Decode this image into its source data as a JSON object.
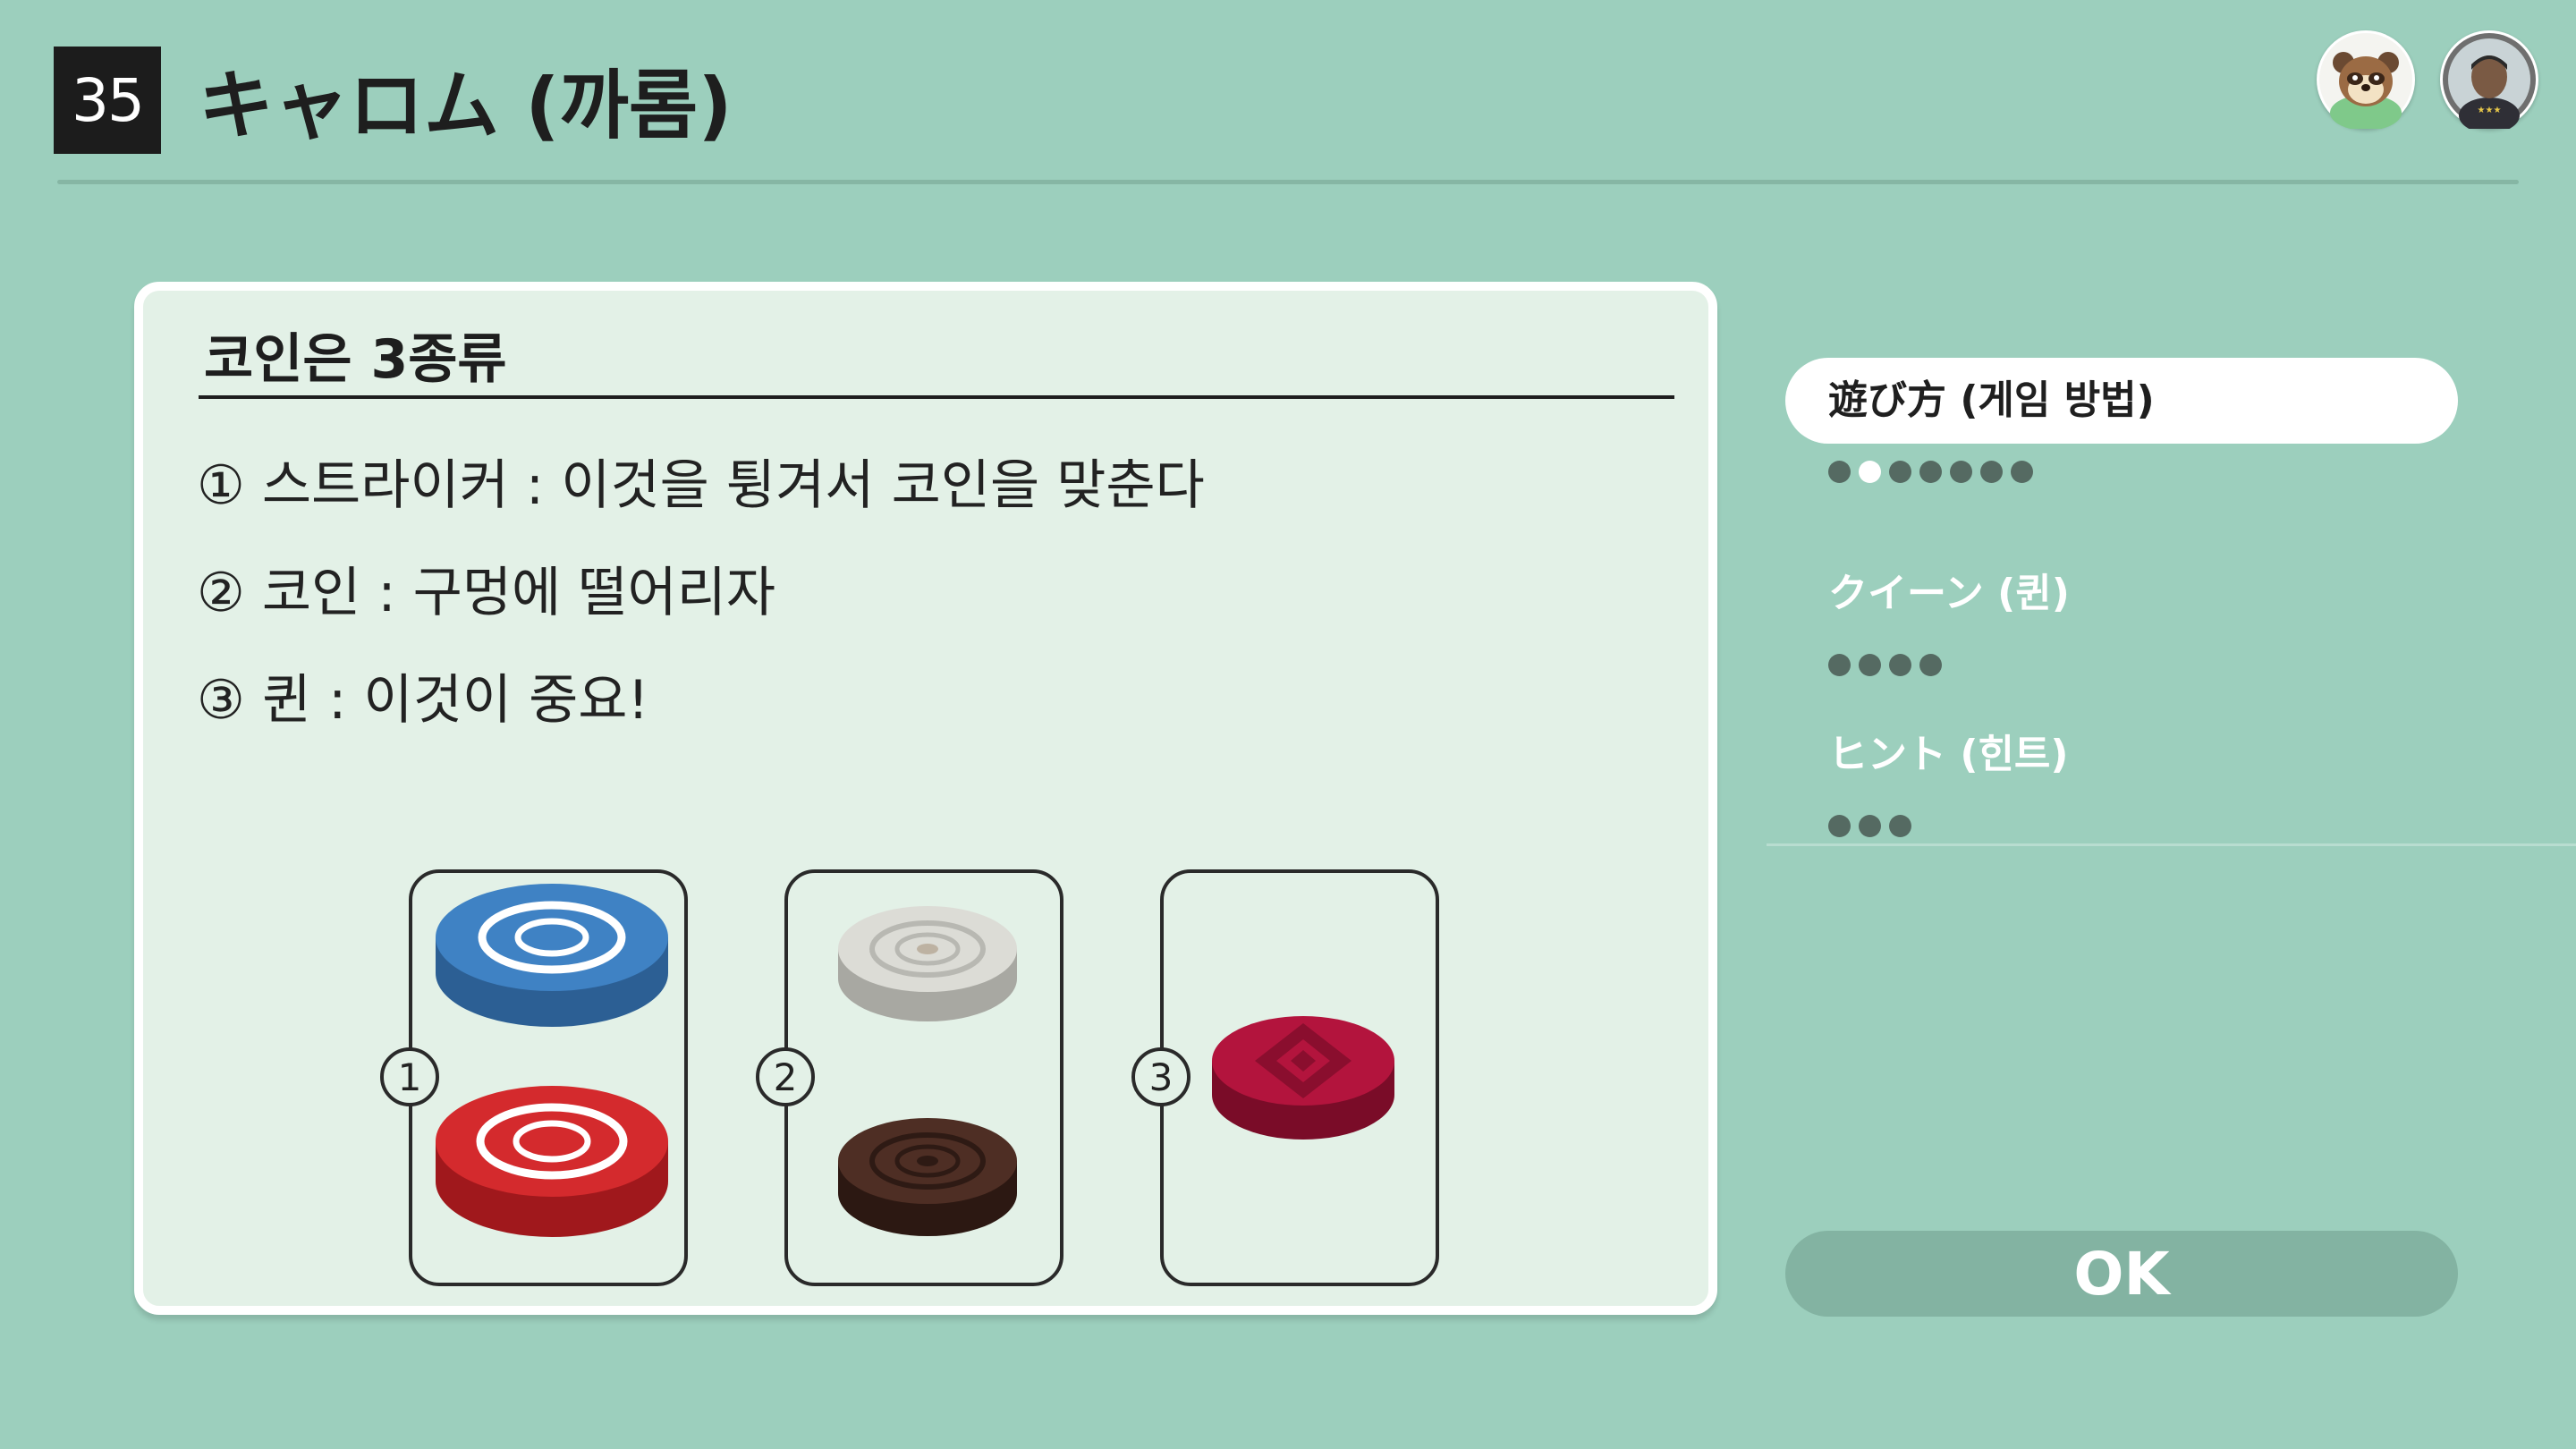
{
  "header": {
    "game_number": "35",
    "game_title": "キャロム (까롬)"
  },
  "avatars": [
    {
      "icon": "tanuki-character-icon"
    },
    {
      "icon": "player-portrait-icon"
    }
  ],
  "panel": {
    "title": "코인은 3종류",
    "lines": [
      "① 스트라이커 : 이것을 튕겨서 코인을 맞춘다",
      "② 코인 : 구멍에 떨어리자",
      "③ 퀸 : 이것이 중요!"
    ],
    "cards": [
      {
        "number": "1",
        "coins": [
          "blue-striker",
          "red-striker"
        ]
      },
      {
        "number": "2",
        "coins": [
          "white-coin",
          "black-coin"
        ]
      },
      {
        "number": "3",
        "coins": [
          "queen-coin"
        ]
      }
    ],
    "colors": {
      "blue": "#3c7fc6",
      "red": "#d42a2d",
      "white": "#d8d8d4",
      "black": "#4a2a22",
      "queen": "#b3143d"
    }
  },
  "menu": {
    "items": [
      {
        "label": "遊び方 (게임 방법)",
        "active": true,
        "dots_total": 7,
        "dots_active": 2
      },
      {
        "label": "クイーン (퀸)",
        "active": false,
        "dots_total": 4,
        "dots_active": 0
      },
      {
        "label": "ヒント (힌트)",
        "active": false,
        "dots_total": 3,
        "dots_active": 0
      }
    ]
  },
  "ok_button": {
    "label": "OK"
  }
}
